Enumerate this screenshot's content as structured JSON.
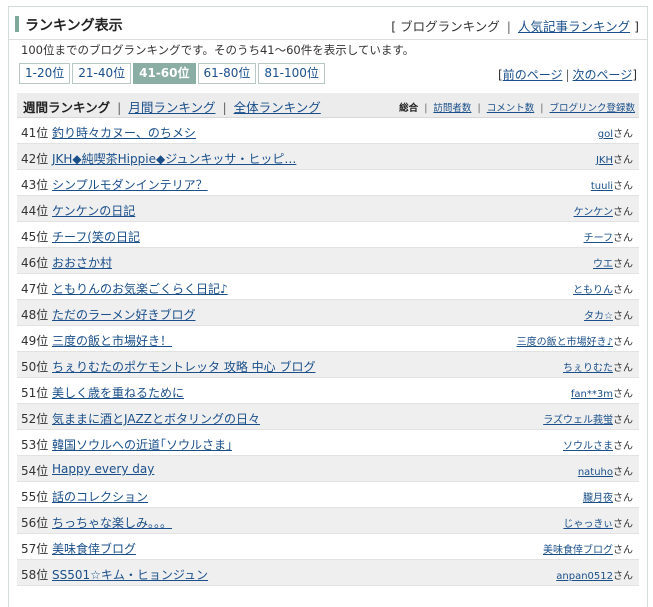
{
  "header": {
    "title": "ランキング表示",
    "open_bracket": "[",
    "blog_ranking": "ブログランキング",
    "separator": "|",
    "popular_ranking": "人気記事ランキング",
    "close_bracket": "]"
  },
  "description": "100位までのブログランキングです。そのうち41〜60件を表示しています。",
  "pager": {
    "ranges": [
      {
        "label": "1-20位",
        "active": false
      },
      {
        "label": "21-40位",
        "active": false
      },
      {
        "label": "41-60位",
        "active": true
      },
      {
        "label": "61-80位",
        "active": false
      },
      {
        "label": "81-100位",
        "active": false
      }
    ],
    "open_bracket": "[",
    "prev": "前のページ",
    "sep": "|",
    "next": "次のページ",
    "close_bracket": "]"
  },
  "tabs": {
    "weekly": "週間ランキング",
    "monthly": "月間ランキング",
    "overall": "全体ランキング",
    "sep": "|",
    "sort": {
      "total": "総合",
      "visits": "訪問者数",
      "comments": "コメント数",
      "links": "ブログリンク登録数"
    }
  },
  "rows": [
    {
      "rank": "41位",
      "title": "釣り時々カヌー、のちメシ",
      "user": "gol",
      "suffix": "さん"
    },
    {
      "rank": "42位",
      "title": "JKH◆純喫茶Hippie◆ジュンキッサ・ヒッピ…",
      "user": "JKH",
      "suffix": "さん"
    },
    {
      "rank": "43位",
      "title": "シンプルモダンインテリア？",
      "user": "tuuli",
      "suffix": "さん"
    },
    {
      "rank": "44位",
      "title": "ケンケンの日記",
      "user": "ケンケン",
      "suffix": "さん"
    },
    {
      "rank": "45位",
      "title": "チーフ(笑の日記",
      "user": "チーフ",
      "suffix": "さん"
    },
    {
      "rank": "46位",
      "title": "おおさか村",
      "user": "ウエ",
      "suffix": "さん"
    },
    {
      "rank": "47位",
      "title": "ともりんのお気楽ごくらく日記♪",
      "user": "ともりん",
      "suffix": "さん"
    },
    {
      "rank": "48位",
      "title": "ただのラーメン好きブログ",
      "user": "タカ☆",
      "suffix": "さん"
    },
    {
      "rank": "49位",
      "title": "三度の飯と市場好き！",
      "user": "三度の飯と市場好き♪",
      "suffix": "さん"
    },
    {
      "rank": "50位",
      "title": "ちぇりむたのポケモントレッタ 攻略 中心 ブログ",
      "user": "ちぇりむた",
      "suffix": "さん"
    },
    {
      "rank": "51位",
      "title": "美しく歳を重ねるために",
      "user": "fan**3m",
      "suffix": "さん"
    },
    {
      "rank": "52位",
      "title": "気ままに酒とJAZZとボタリングの日々",
      "user": "ラズウェル莪蛍",
      "suffix": "さん"
    },
    {
      "rank": "53位",
      "title": "韓国ソウルへの近道｢ソウルさま｣",
      "user": "ソウルさま",
      "suffix": "さん"
    },
    {
      "rank": "54位",
      "title": "Happy every day",
      "user": "natuho",
      "suffix": "さん"
    },
    {
      "rank": "55位",
      "title": "話のコレクション",
      "user": "朧月夜",
      "suffix": "さん"
    },
    {
      "rank": "56位",
      "title": "ちっちゃな楽しみ。。。",
      "user": "じゃっきぃ",
      "suffix": "さん"
    },
    {
      "rank": "57位",
      "title": "美味食倖ブログ",
      "user": "美味食倖ブログ",
      "suffix": "さん"
    },
    {
      "rank": "58位",
      "title": "SS501☆キム・ヒョンジュン",
      "user": "anpan0512",
      "suffix": "さん"
    }
  ]
}
